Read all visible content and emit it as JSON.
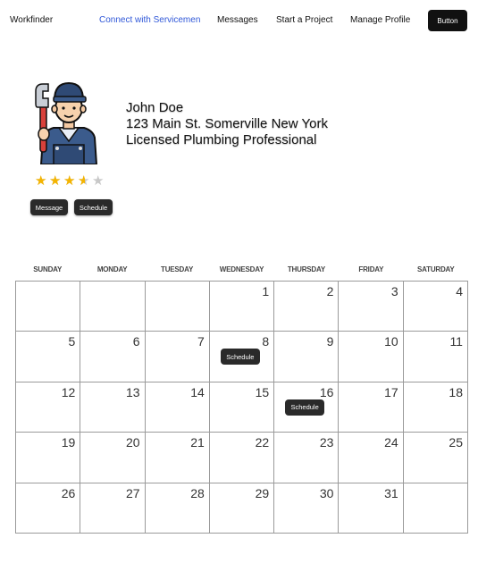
{
  "nav": {
    "brand": "Workfinder",
    "links": [
      "Connect with Servicemen",
      "Messages",
      "Start a Project",
      "Manage Profile"
    ],
    "button": "Button",
    "accent": "#2f57d8"
  },
  "profile": {
    "avatar_icon": "plumber-avatar-icon",
    "name": "John Doe",
    "address": "123 Main St. Somerville New York",
    "title": "Licensed Plumbing Professional",
    "rating": 3.5,
    "rating_max": 5,
    "message_label": "Message",
    "schedule_label": "Schedule"
  },
  "calendar": {
    "days_of_week": [
      "SUNDAY",
      "MONDAY",
      "TUESDAY",
      "WEDNESDAY",
      "THURSDAY",
      "FRIDAY",
      "SATURDAY"
    ],
    "weeks": [
      [
        "",
        "",
        "",
        "1",
        "2",
        "3",
        "4"
      ],
      [
        "5",
        "6",
        "7",
        "8",
        "9",
        "10",
        "11"
      ],
      [
        "12",
        "13",
        "14",
        "15",
        "16",
        "17",
        "18"
      ],
      [
        "19",
        "20",
        "21",
        "22",
        "23",
        "24",
        "25"
      ],
      [
        "26",
        "27",
        "28",
        "29",
        "30",
        "31",
        ""
      ]
    ],
    "schedule_days": [
      "8",
      "16"
    ],
    "schedule_label": "Schedule"
  }
}
